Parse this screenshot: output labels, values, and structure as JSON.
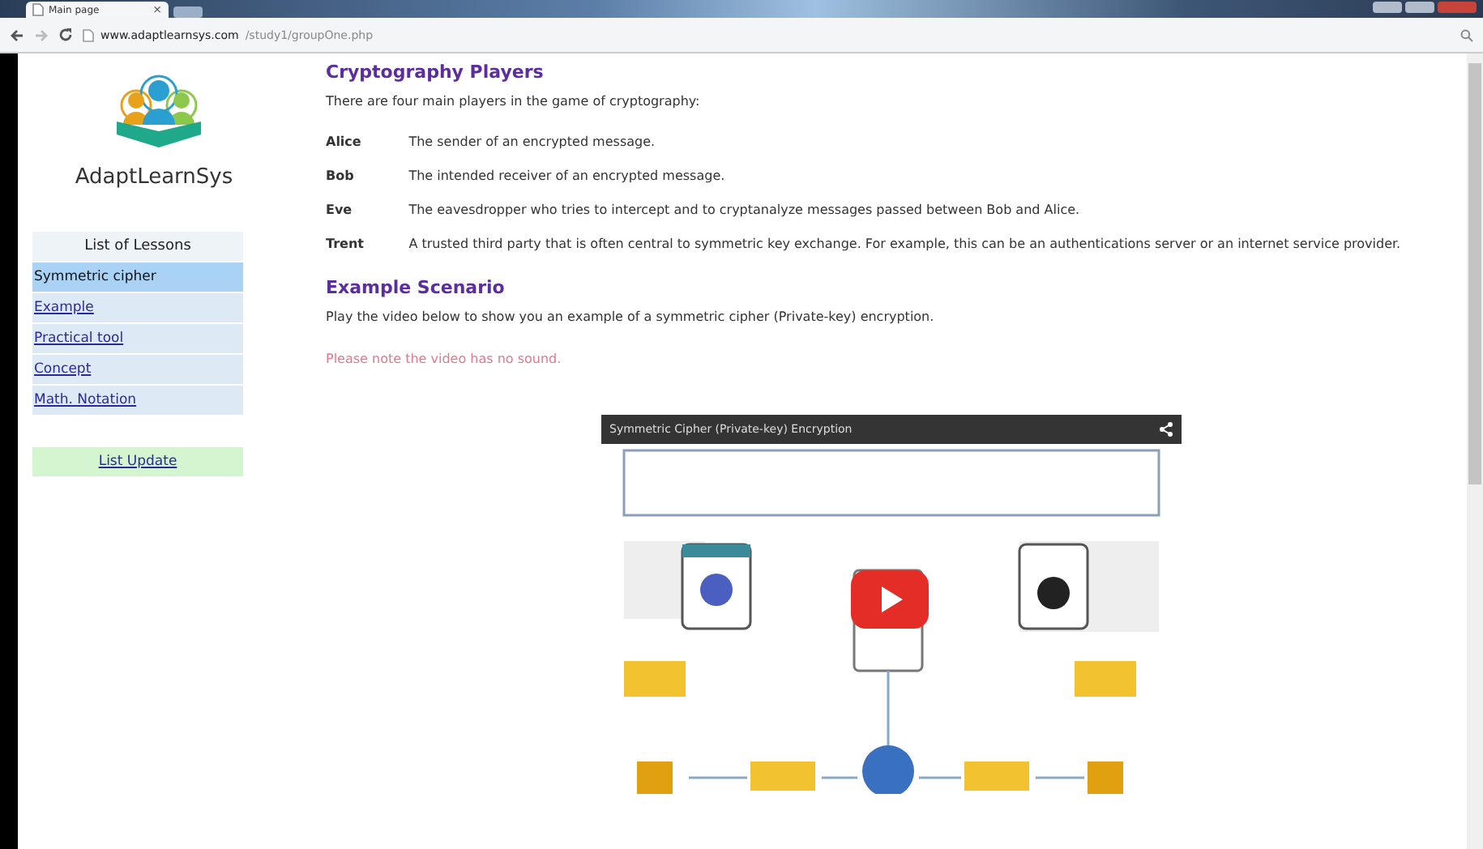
{
  "browser": {
    "tab_title": "Main page",
    "tab_close": "×",
    "url_host": "www.adaptlearnsys.com",
    "url_path": "/study1/groupOne.php"
  },
  "sidebar": {
    "brand": "AdaptLearnSys",
    "lessons_heading": "List of Lessons",
    "lessons": [
      {
        "label": "Symmetric cipher",
        "selected": true
      },
      {
        "label": "Example",
        "selected": false
      },
      {
        "label": "Practical tool",
        "selected": false
      },
      {
        "label": "Concept",
        "selected": false
      },
      {
        "label": "Math. Notation",
        "selected": false
      }
    ],
    "update_button": "List Update"
  },
  "main": {
    "heading": "Cryptography Players",
    "intro": "There are four main players in the game of cryptography:",
    "players": [
      {
        "name": "Alice",
        "description": "The sender of an encrypted message."
      },
      {
        "name": "Bob",
        "description": "The intended receiver of an encrypted message."
      },
      {
        "name": "Eve",
        "description": "The eavesdropper who tries to intercept and to cryptanalyze messages passed between Bob and Alice."
      },
      {
        "name": "Trent",
        "description": "A trusted third party that is often central to symmetric key exchange. For example, this can be an authentications server or an internet service provider."
      }
    ],
    "section_heading": "Example Scenario",
    "section_text": "Play the video below to show you an example of a symmetric cipher (Private-key) encryption.",
    "note": "Please note the video has no sound."
  },
  "video": {
    "title": "Symmetric Cipher (Private-key) Encryption"
  }
}
